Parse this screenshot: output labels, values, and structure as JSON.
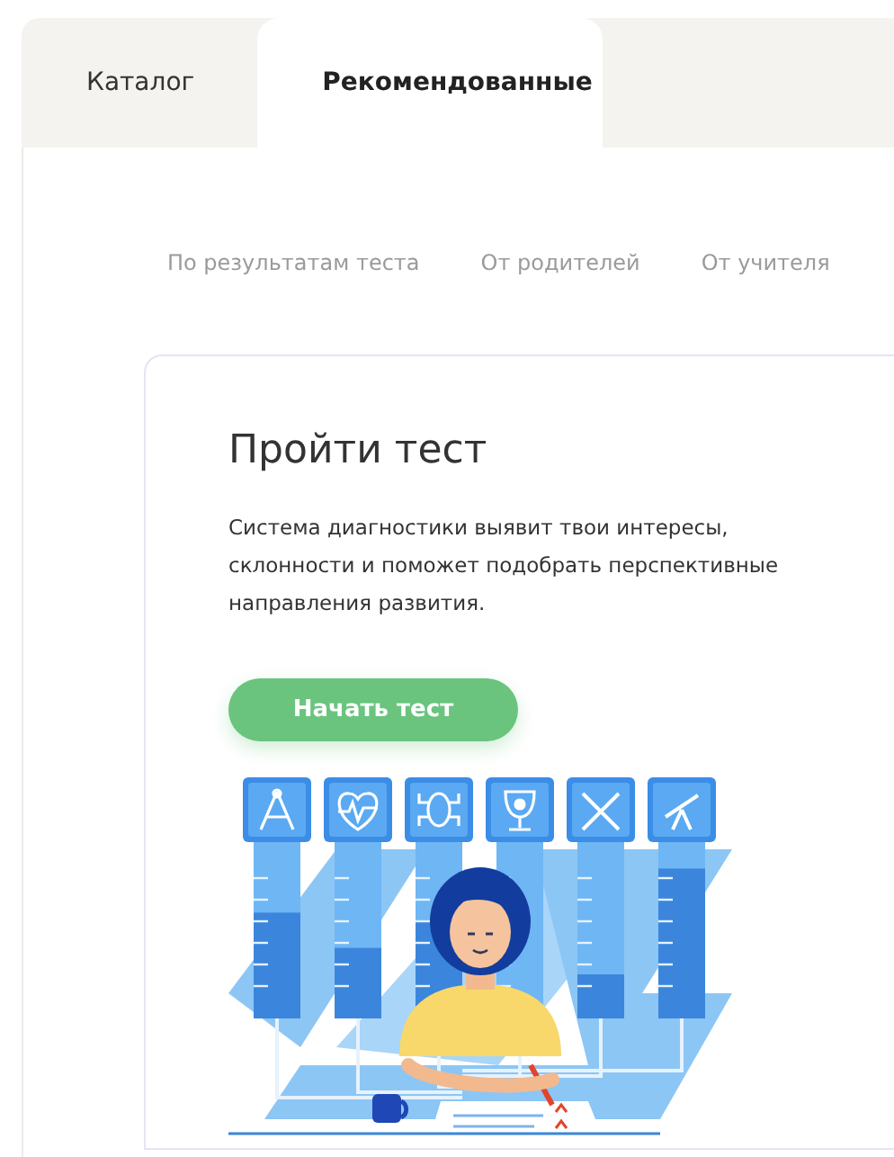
{
  "tabs": [
    {
      "label": "Каталог",
      "selected": false
    },
    {
      "label": "Рекомендованные",
      "selected": true
    }
  ],
  "subtabs": [
    {
      "label": "По результатам теста",
      "selected": false
    },
    {
      "label": "От родителей",
      "selected": false
    },
    {
      "label": "От учителя",
      "selected": false
    }
  ],
  "card": {
    "title": "Пройти тест",
    "description": "Система диагностики выявит твои интересы, склонности и поможет подобрать перспективные направления развития.",
    "button": "Начать тест"
  }
}
